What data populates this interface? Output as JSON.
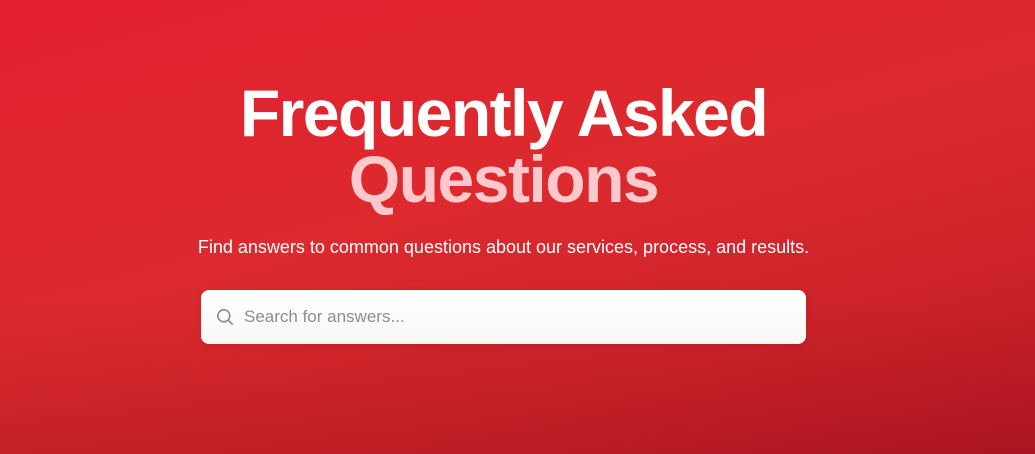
{
  "hero": {
    "title_line1": "Frequently Asked",
    "title_line2": "Questions",
    "subtitle": "Find answers to common questions about our services, process, and results."
  },
  "search": {
    "placeholder": "Search for answers...",
    "value": "",
    "icon": "search-icon"
  },
  "colors": {
    "background_red": "#e02530",
    "title_white": "#ffffff",
    "title_accent_pink": "#fdc9cc",
    "placeholder_gray": "#8b8f98"
  }
}
